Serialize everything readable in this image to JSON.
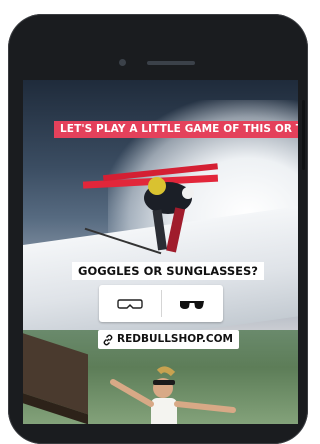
{
  "story": {
    "prompt_banner": "LET'S PLAY A LITTLE GAME OF THIS OR THAT.",
    "question": "GOGGLES OR SUNGLASSES?",
    "poll": {
      "option_left_icon": "goggles-icon",
      "option_right_icon": "sunglasses-icon"
    },
    "link_sticker": {
      "icon": "link-icon",
      "text": "REDBULLSHOP.COM"
    }
  },
  "colors": {
    "banner_red": "#e4415b",
    "sticker_white": "#ffffff",
    "phone_body": "#1a1c1f"
  }
}
